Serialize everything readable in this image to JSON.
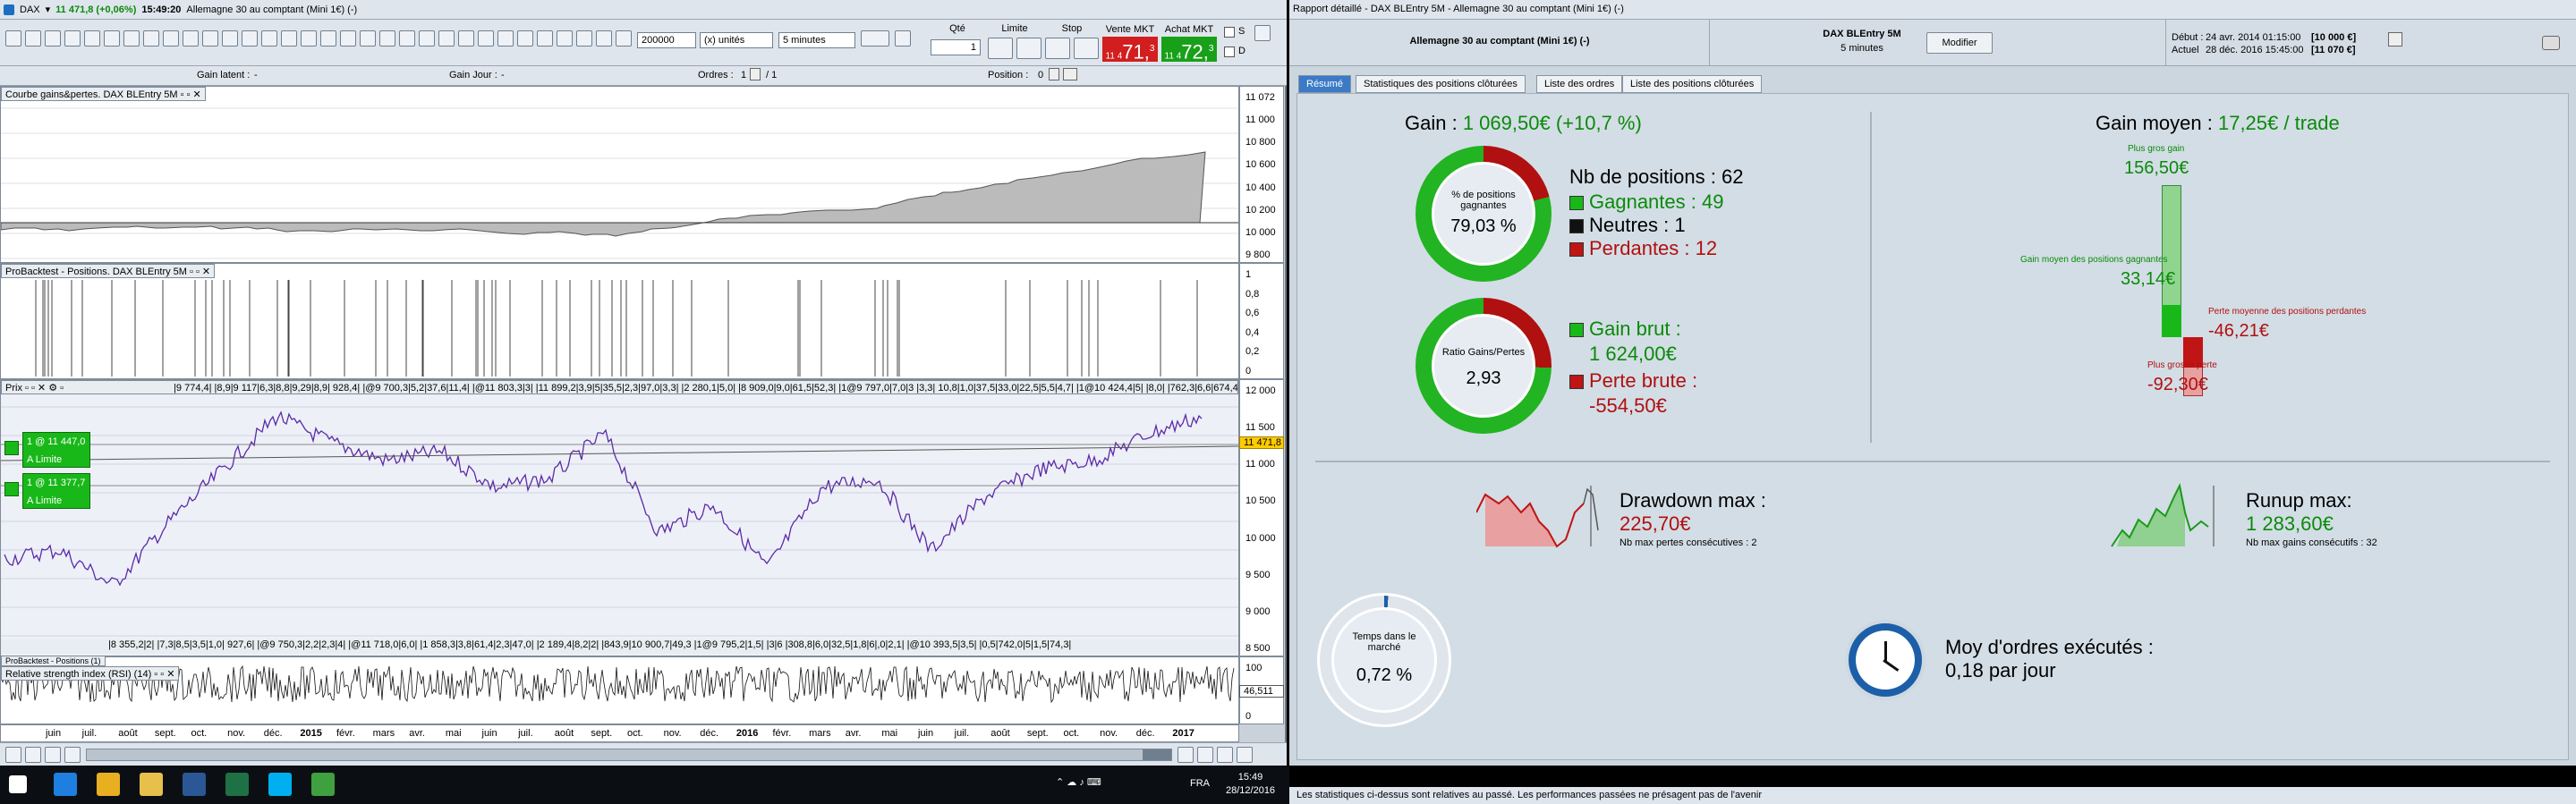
{
  "left_window": {
    "title_instrument": "DAX",
    "title_price": "11 471,8 (+0,06%)",
    "title_time": "15:49:20",
    "title_desc": "Allemagne 30 au comptant (Mini 1€) (-)",
    "toolbar": {
      "quantity_value": "200000",
      "units_select": "(x) unités",
      "interval_select": "5 minutes",
      "qty_label": "Qté",
      "qty_value": "1",
      "limit_label": "Limite",
      "stop_label": "Stop",
      "sell_label": "Vente MKT",
      "sell_price_small": "11 4",
      "sell_price_big": "71,",
      "sell_price_sup": "3",
      "buy_label": "Achat MKT",
      "buy_price_small": "11 4",
      "buy_price_big": "72,",
      "buy_price_sup": "3",
      "s_label": "S",
      "d_label": "D"
    },
    "infobar": {
      "latent": "Gain latent :",
      "latent_val": "-",
      "day": "Gain Jour :",
      "day_val": "-",
      "orders": "Ordres :",
      "orders_val": "1",
      "orders_val2": "/ 1",
      "position": "Position :",
      "position_val": "0"
    },
    "panels": {
      "equity_title": "Courbe gains&pertes. DAX BLEntry 5M",
      "positions_title": "ProBacktest - Positions. DAX BLEntry 5M",
      "price_title": "Prix",
      "price_tick_text": "|9 774,4|   |8,9|9 117|6,3|8,8|9,29|8,9|   928,4|   |@9 700,3|5,2|37,6|11,4|   |@11 803,3|3|   |11 899,2|3,9|5|35,5|2,3|97,0|3,3|   |2 280,1|5,0|   |8   909,0|9,0|61,5|52,3|   |1@9 797,0|7,0|3   |3,3|   10,8|1,0|37,5|33,0|22,5|5,5|4,7|   |1@10 424,4|5|   |8,0|   |762,3|6,6|674,4|",
      "price_bottom_text": "|8 355,2|2|   |7,3|8,5|3,5|1,0|   927,6|   |@9 750,3|2,2|2,3|4|   |@11 718,0|6,0|   |1 858,3|3,8|61,4|2,3|47,0|   |2 189,4|8,2|2|   |843,9|10 900,7|49,3   |1@9 795,2|1,5|   |3|6   |308,8|6,0|32,5|1,8|6|,0|2,1|   |@10 393,5|3,5|   |0,5|742,0|5|1,5|74,3|",
      "order1": "1 @ 11 447,0",
      "order1_sub": "A Limite",
      "order2": "1 @ 11 377,7",
      "order2_sub": "A Limite",
      "rsi_small_title": "ProBacktest - Positions (1)",
      "rsi_title": "Relative strength index (RSI) (14)",
      "price_current": "11 471,8",
      "rsi_current": "46,511"
    },
    "y_equity": [
      "11 072",
      "11 000",
      "10 800",
      "10 600",
      "10 400",
      "10 200",
      "10 000",
      "9 800"
    ],
    "y_positions": [
      "1",
      "0,8",
      "0,6",
      "0,4",
      "0,2",
      "0"
    ],
    "y_price": [
      "12 000",
      "11 500",
      "11 000",
      "10 500",
      "10 000",
      "9 500",
      "9 000",
      "8 500"
    ],
    "y_rsi": [
      "100",
      "0"
    ],
    "x_labels": [
      "juin",
      "juil.",
      "août",
      "sept.",
      "oct.",
      "nov.",
      "déc.",
      "2015",
      "févr.",
      "mars",
      "avr.",
      "mai",
      "juin",
      "juil.",
      "août",
      "sept.",
      "oct.",
      "nov.",
      "déc.",
      "2016",
      "févr.",
      "mars",
      "avr.",
      "mai",
      "juin",
      "juil.",
      "août",
      "sept.",
      "oct.",
      "nov.",
      "déc.",
      "2017"
    ]
  },
  "right_window": {
    "title": "Rapport détaillé - DAX BLEntry 5M - Allemagne 30 au comptant (Mini 1€) (-)",
    "header": {
      "instrument": "Allemagne 30 au comptant (Mini 1€) (-)",
      "system": "DAX BLEntry 5M",
      "interval": "5 minutes",
      "modify": "Modifier",
      "start_label": "Début :",
      "start_date": "24 avr. 2014 01:15:00",
      "start_amount": "[10 000 €]",
      "end_label": "Actuel",
      "end_date": "28 déc. 2016 15:45:00",
      "end_amount": "[11 070 €]"
    },
    "tabs": [
      "Résumé",
      "Statistiques des positions clôturées",
      "Liste des ordres",
      "Liste des positions clôturées"
    ],
    "summary": {
      "gain_label": "Gain :",
      "gain_value": "1 069,50€ (+10,7 %)",
      "ring1_label": "% de positions gagnantes",
      "ring1_value": "79,03 %",
      "ring1_fraction": 0.7903,
      "nb_positions": "Nb de positions : 62",
      "winning": "Gagnantes : 49",
      "neutral": "Neutres : 1",
      "losing": "Perdantes : 12",
      "ring2_label": "Ratio Gains/Pertes",
      "ring2_value": "2,93",
      "ring2_fraction": 0.7455,
      "gross_gain_label": "Gain brut :",
      "gross_gain_value": "1 624,00€",
      "gross_loss_label": "Perte brute :",
      "gross_loss_value": "-554,50€",
      "avg_gain_label": "Gain moyen :",
      "avg_gain_value": "17,25€ / trade",
      "best_gain_label": "Plus gros gain",
      "best_gain_value": "156,50€",
      "avg_winning_label": "Gain moyen des positions gagnantes",
      "avg_winning_value": "33,14€",
      "avg_losing_label": "Perte moyenne des positions perdantes",
      "avg_losing_value": "-46,21€",
      "worst_loss_label": "Plus grosse perte",
      "worst_loss_value": "-92,30€",
      "drawdown_label": "Drawdown max :",
      "drawdown_value": "225,70€",
      "drawdown_sub": "Nb max pertes consécutives : 2",
      "runup_label": "Runup max:",
      "runup_value": "1 283,60€",
      "runup_sub": "Nb max gains consécutifs : 32",
      "time_label": "Temps dans le marché",
      "time_value": "0,72 %",
      "time_fraction": 0.0072,
      "orders_label": "Moy d'ordres exécutés :",
      "orders_value": "0,18 par jour"
    },
    "footer": "Les statistiques ci-dessus sont relatives au passé. Les performances passées ne présagent pas de l'avenir"
  },
  "taskbar": {
    "time": "15:49",
    "date": "28/12/2016",
    "lang": "FRA"
  },
  "colors": {
    "green": "#19b819",
    "red": "#b01010",
    "accent": "#3a7ac7",
    "price_line": "#5a2aa8"
  }
}
